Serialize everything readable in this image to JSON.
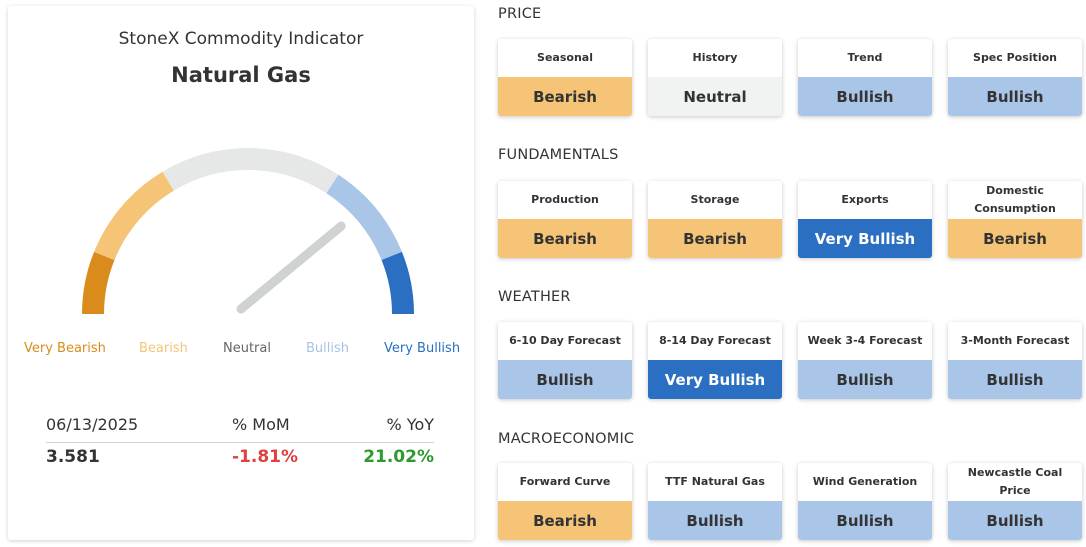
{
  "indicator": {
    "title": "StoneX Commodity Indicator",
    "commodity": "Natural Gas",
    "gauge_level": 0.78,
    "scale_labels": [
      "Very Bearish",
      "Bearish",
      "Neutral",
      "Bullish",
      "Very Bullish"
    ],
    "colors": {
      "very_bearish": "#d98c1c",
      "bearish": "#f6c477",
      "neutral": "#e6e7e7",
      "bullish": "#a9c5e8",
      "very_bullish": "#2a6fc2",
      "needle": "#cfd2d2"
    }
  },
  "stats": {
    "date": "06/13/2025",
    "mom_header": "% MoM",
    "yoy_header": "% YoY",
    "price": "3.581",
    "mom": "-1.81%",
    "yoy": "21.02%"
  },
  "sections": [
    {
      "title": "PRICE",
      "cards": [
        {
          "label": "Seasonal",
          "value": "Bearish",
          "status": "bearish"
        },
        {
          "label": "History",
          "value": "Neutral",
          "status": "neutral"
        },
        {
          "label": "Trend",
          "value": "Bullish",
          "status": "bullish"
        },
        {
          "label": "Spec Position",
          "value": "Bullish",
          "status": "bullish"
        }
      ]
    },
    {
      "title": "FUNDAMENTALS",
      "cards": [
        {
          "label": "Production",
          "value": "Bearish",
          "status": "bearish"
        },
        {
          "label": "Storage",
          "value": "Bearish",
          "status": "bearish"
        },
        {
          "label": "Exports",
          "value": "Very Bullish",
          "status": "vbullish"
        },
        {
          "label": "Domestic Consumption",
          "value": "Bearish",
          "status": "bearish"
        }
      ]
    },
    {
      "title": "WEATHER",
      "cards": [
        {
          "label": "6-10 Day Forecast",
          "value": "Bullish",
          "status": "bullish"
        },
        {
          "label": "8-14 Day Forecast",
          "value": "Very Bullish",
          "status": "vbullish"
        },
        {
          "label": "Week 3-4 Forecast",
          "value": "Bullish",
          "status": "bullish"
        },
        {
          "label": "3-Month Forecast",
          "value": "Bullish",
          "status": "bullish"
        }
      ]
    },
    {
      "title": "MACROECONOMIC",
      "cards": [
        {
          "label": "Forward Curve",
          "value": "Bearish",
          "status": "bearish"
        },
        {
          "label": "TTF Natural Gas",
          "value": "Bullish",
          "status": "bullish"
        },
        {
          "label": "Wind Generation",
          "value": "Bullish",
          "status": "bullish"
        },
        {
          "label": "Newcastle Coal Price",
          "value": "Bullish",
          "status": "bullish"
        }
      ]
    }
  ]
}
